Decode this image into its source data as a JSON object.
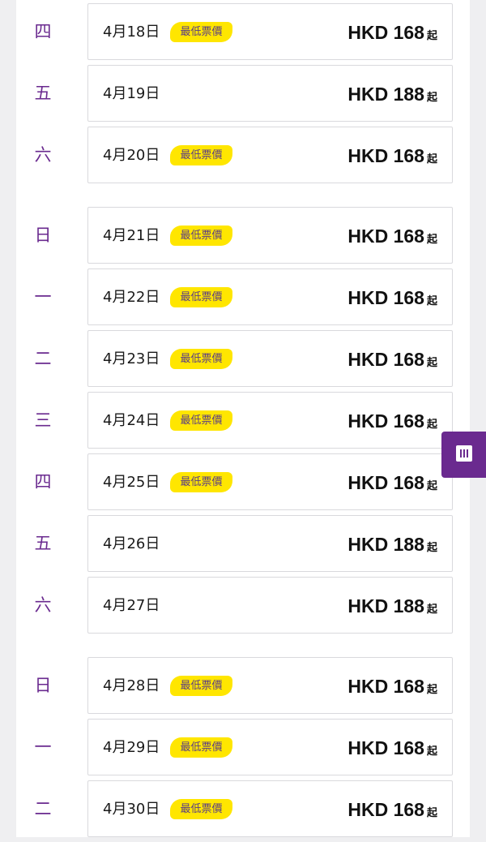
{
  "badge_label": "最低票價",
  "from_suffix": "起",
  "colors": {
    "accent": "#6a2a8f",
    "badge": "#ffe600"
  },
  "days": [
    {
      "weekday": "四",
      "date": "4月18日",
      "lowest": true,
      "price": "HKD 168"
    },
    {
      "weekday": "五",
      "date": "4月19日",
      "lowest": false,
      "price": "HKD 188"
    },
    {
      "weekday": "六",
      "date": "4月20日",
      "lowest": true,
      "price": "HKD 168"
    },
    {
      "weekday": "日",
      "date": "4月21日",
      "lowest": true,
      "price": "HKD 168"
    },
    {
      "weekday": "一",
      "date": "4月22日",
      "lowest": true,
      "price": "HKD 168"
    },
    {
      "weekday": "二",
      "date": "4月23日",
      "lowest": true,
      "price": "HKD 168"
    },
    {
      "weekday": "三",
      "date": "4月24日",
      "lowest": true,
      "price": "HKD 168"
    },
    {
      "weekday": "四",
      "date": "4月25日",
      "lowest": true,
      "price": "HKD 168"
    },
    {
      "weekday": "五",
      "date": "4月26日",
      "lowest": false,
      "price": "HKD 188"
    },
    {
      "weekday": "六",
      "date": "4月27日",
      "lowest": false,
      "price": "HKD 188"
    },
    {
      "weekday": "日",
      "date": "4月28日",
      "lowest": true,
      "price": "HKD 168"
    },
    {
      "weekday": "一",
      "date": "4月29日",
      "lowest": true,
      "price": "HKD 168"
    },
    {
      "weekday": "二",
      "date": "4月30日",
      "lowest": true,
      "price": "HKD 168"
    }
  ],
  "side_tab_icon": "calendar-grid-icon"
}
